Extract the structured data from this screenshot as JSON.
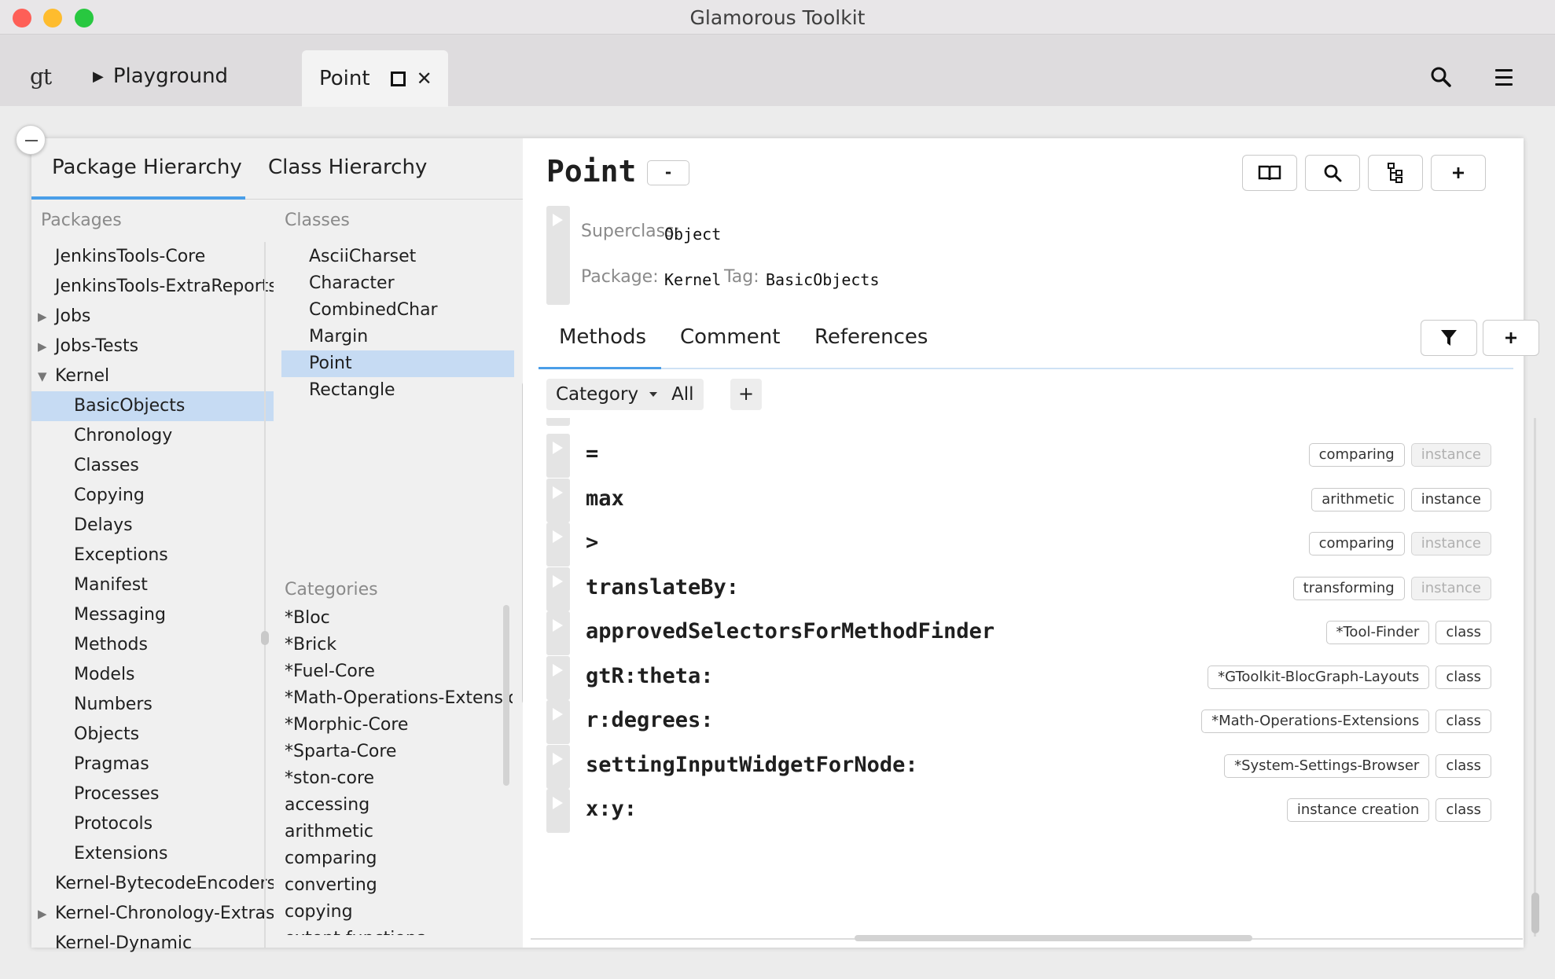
{
  "window": {
    "title": "Glamorous Toolkit",
    "traffic_colors": {
      "close": "#fe5f57",
      "minimize": "#febc2e",
      "zoom": "#28c840"
    }
  },
  "tabbar": {
    "logo": "gt",
    "playground_label": "Playground",
    "active_tab_label": "Point",
    "search_icon": "search-icon",
    "menu_icon": "hamburger-menu-icon"
  },
  "left": {
    "tabs": {
      "package_hierarchy": "Package Hierarchy",
      "class_hierarchy": "Class Hierarchy"
    },
    "packages_label": "Packages",
    "classes_label": "Classes",
    "categories_label": "Categories",
    "packages": [
      {
        "label": "JenkinsTools-Core",
        "indent": 0,
        "arrow": ""
      },
      {
        "label": "JenkinsTools-ExtraReports",
        "indent": 0,
        "arrow": ""
      },
      {
        "label": "Jobs",
        "indent": 0,
        "arrow": "▶"
      },
      {
        "label": "Jobs-Tests",
        "indent": 0,
        "arrow": "▶"
      },
      {
        "label": "Kernel",
        "indent": 0,
        "arrow": "▼"
      },
      {
        "label": "BasicObjects",
        "indent": 1,
        "arrow": "",
        "selected": true
      },
      {
        "label": "Chronology",
        "indent": 1,
        "arrow": ""
      },
      {
        "label": "Classes",
        "indent": 1,
        "arrow": ""
      },
      {
        "label": "Copying",
        "indent": 1,
        "arrow": ""
      },
      {
        "label": "Delays",
        "indent": 1,
        "arrow": ""
      },
      {
        "label": "Exceptions",
        "indent": 1,
        "arrow": ""
      },
      {
        "label": "Manifest",
        "indent": 1,
        "arrow": ""
      },
      {
        "label": "Messaging",
        "indent": 1,
        "arrow": ""
      },
      {
        "label": "Methods",
        "indent": 1,
        "arrow": ""
      },
      {
        "label": "Models",
        "indent": 1,
        "arrow": ""
      },
      {
        "label": "Numbers",
        "indent": 1,
        "arrow": ""
      },
      {
        "label": "Objects",
        "indent": 1,
        "arrow": ""
      },
      {
        "label": "Pragmas",
        "indent": 1,
        "arrow": ""
      },
      {
        "label": "Processes",
        "indent": 1,
        "arrow": ""
      },
      {
        "label": "Protocols",
        "indent": 1,
        "arrow": ""
      },
      {
        "label": "Extensions",
        "indent": 1,
        "arrow": ""
      },
      {
        "label": "Kernel-BytecodeEncoders",
        "indent": 0,
        "arrow": ""
      },
      {
        "label": "Kernel-Chronology-Extras",
        "indent": 0,
        "arrow": "▶"
      },
      {
        "label": "Kernel-Dynamic",
        "indent": 0,
        "arrow": ""
      }
    ],
    "classes": [
      {
        "label": "AsciiCharset"
      },
      {
        "label": "Character"
      },
      {
        "label": "CombinedChar"
      },
      {
        "label": "Margin"
      },
      {
        "label": "Point",
        "selected": true
      },
      {
        "label": "Rectangle"
      }
    ],
    "categories": [
      "*Bloc",
      "*Brick",
      "*Fuel-Core",
      "*Math-Operations-Extensions",
      "*Morphic-Core",
      "*Sparta-Core",
      "*ston-core",
      "accessing",
      "arithmetic",
      "comparing",
      "converting",
      "copying",
      "extent functions"
    ]
  },
  "right": {
    "class_name": "Point",
    "collapse_label": "-",
    "toolbar_icons": [
      "book-icon",
      "search-icon",
      "hierarchy-icon",
      "plus-icon"
    ],
    "superclass_label": "Superclass:",
    "superclass_value": "Object",
    "package_label": "Package:",
    "package_value": "Kernel",
    "tag_label": "Tag:",
    "tag_value": "BasicObjects",
    "tabs": {
      "methods": "Methods",
      "comment": "Comment",
      "references": "References"
    },
    "filter": {
      "category": "Category",
      "all": "All",
      "add": "+"
    },
    "methods": [
      {
        "selector": "=",
        "tags": [
          {
            "text": "comparing"
          },
          {
            "text": "instance",
            "dim": true
          }
        ]
      },
      {
        "selector": "max",
        "tags": [
          {
            "text": "arithmetic"
          },
          {
            "text": "instance"
          }
        ]
      },
      {
        "selector": ">",
        "tags": [
          {
            "text": "comparing"
          },
          {
            "text": "instance",
            "dim": true
          }
        ]
      },
      {
        "selector": "translateBy:",
        "tags": [
          {
            "text": "transforming"
          },
          {
            "text": "instance",
            "dim": true
          }
        ]
      },
      {
        "selector": "approvedSelectorsForMethodFinder",
        "tags": [
          {
            "text": "*Tool-Finder"
          },
          {
            "text": "class"
          }
        ]
      },
      {
        "selector": "gtR:theta:",
        "tags": [
          {
            "text": "*GToolkit-BlocGraph-Layouts"
          },
          {
            "text": "class"
          }
        ]
      },
      {
        "selector": "r:degrees:",
        "tags": [
          {
            "text": "*Math-Operations-Extensions"
          },
          {
            "text": "class"
          }
        ]
      },
      {
        "selector": "settingInputWidgetForNode:",
        "tags": [
          {
            "text": "*System-Settings-Browser"
          },
          {
            "text": "class"
          }
        ]
      },
      {
        "selector": "x:y:",
        "tags": [
          {
            "text": "instance creation"
          },
          {
            "text": "class"
          }
        ]
      }
    ]
  }
}
